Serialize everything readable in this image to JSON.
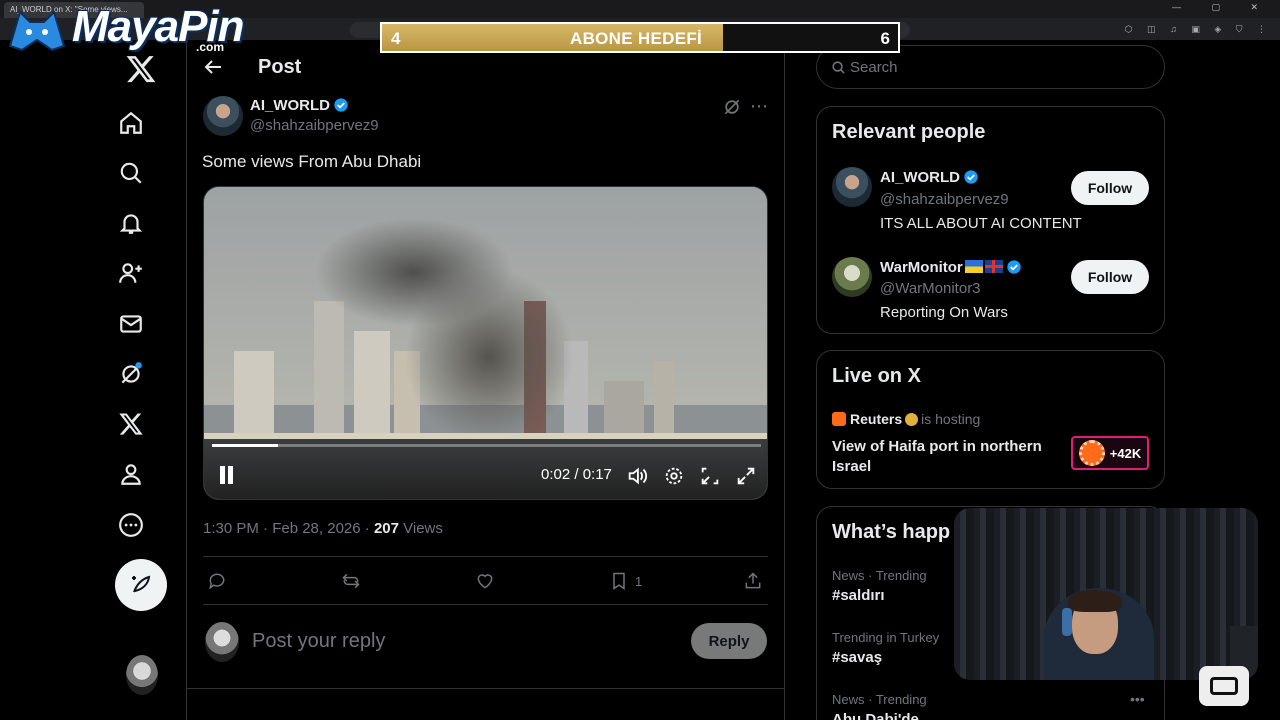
{
  "browser": {
    "tab_title": "AI_WORLD on X: \"Some views...",
    "window_controls": "— ▢ ✕",
    "extensions": "⬡ ◫ ♫ ▣ ◈ ⛉ ⋮"
  },
  "overlay": {
    "logo_word": "MayaPin",
    "logo_domain": ".com",
    "goal_current": "4",
    "goal_label": "ABONE HEDEFİ",
    "goal_target": "6",
    "goal_progress_fraction": 0.66
  },
  "nav": {
    "items": [
      "home-icon",
      "explore-icon",
      "notifications-icon",
      "follow-icon",
      "messages-icon",
      "grok-icon",
      "premium-icon",
      "profile-icon",
      "more-icon"
    ],
    "compose_icon": "compose-post-icon"
  },
  "post": {
    "header_title": "Post",
    "author_name": "AI_WORLD",
    "author_handle": "@shahzaibpervez9",
    "text": "Some views From Abu Dhabi",
    "video_time": "0:02 / 0:17",
    "video_progress_fraction": 0.12,
    "timestamp": "1:30 PM · Feb 28, 2026 · ",
    "views_count": "207",
    "views_label": " Views",
    "bookmark_count": "1",
    "reply_placeholder": "Post your reply",
    "reply_button": "Reply"
  },
  "sidebar": {
    "search_placeholder": "Search",
    "relevant_title": "Relevant people",
    "people": [
      {
        "name": "AI_WORLD",
        "handle": "@shahzaibpervez9",
        "bio": "ITS ALL ABOUT AI CONTENT",
        "follow": "Follow"
      },
      {
        "name": "WarMonitor",
        "handle": "@WarMonitor3",
        "bio": "Reporting On Wars",
        "follow": "Follow"
      }
    ],
    "live_title": "Live on X",
    "live_host": "Reuters",
    "live_host_suffix": "is hosting",
    "live_stream_title": "View of Haifa port in northern Israel",
    "live_count": "+42K",
    "happening_title": "What’s happ",
    "trends": [
      {
        "context": "News · Trending",
        "name": "#saldırı"
      },
      {
        "context": "Trending in Turkey",
        "name": "#savaş"
      },
      {
        "context": "News · Trending",
        "name": "Abu Dabi'de"
      }
    ]
  },
  "colors": {
    "background": "#000000",
    "text_primary": "#e7e9ea",
    "text_secondary": "#71767b",
    "border": "#2f3336",
    "verified_blue": "#1d9bf0",
    "goal_gold": "#c9a852",
    "live_badge_border": "#e11d74"
  }
}
